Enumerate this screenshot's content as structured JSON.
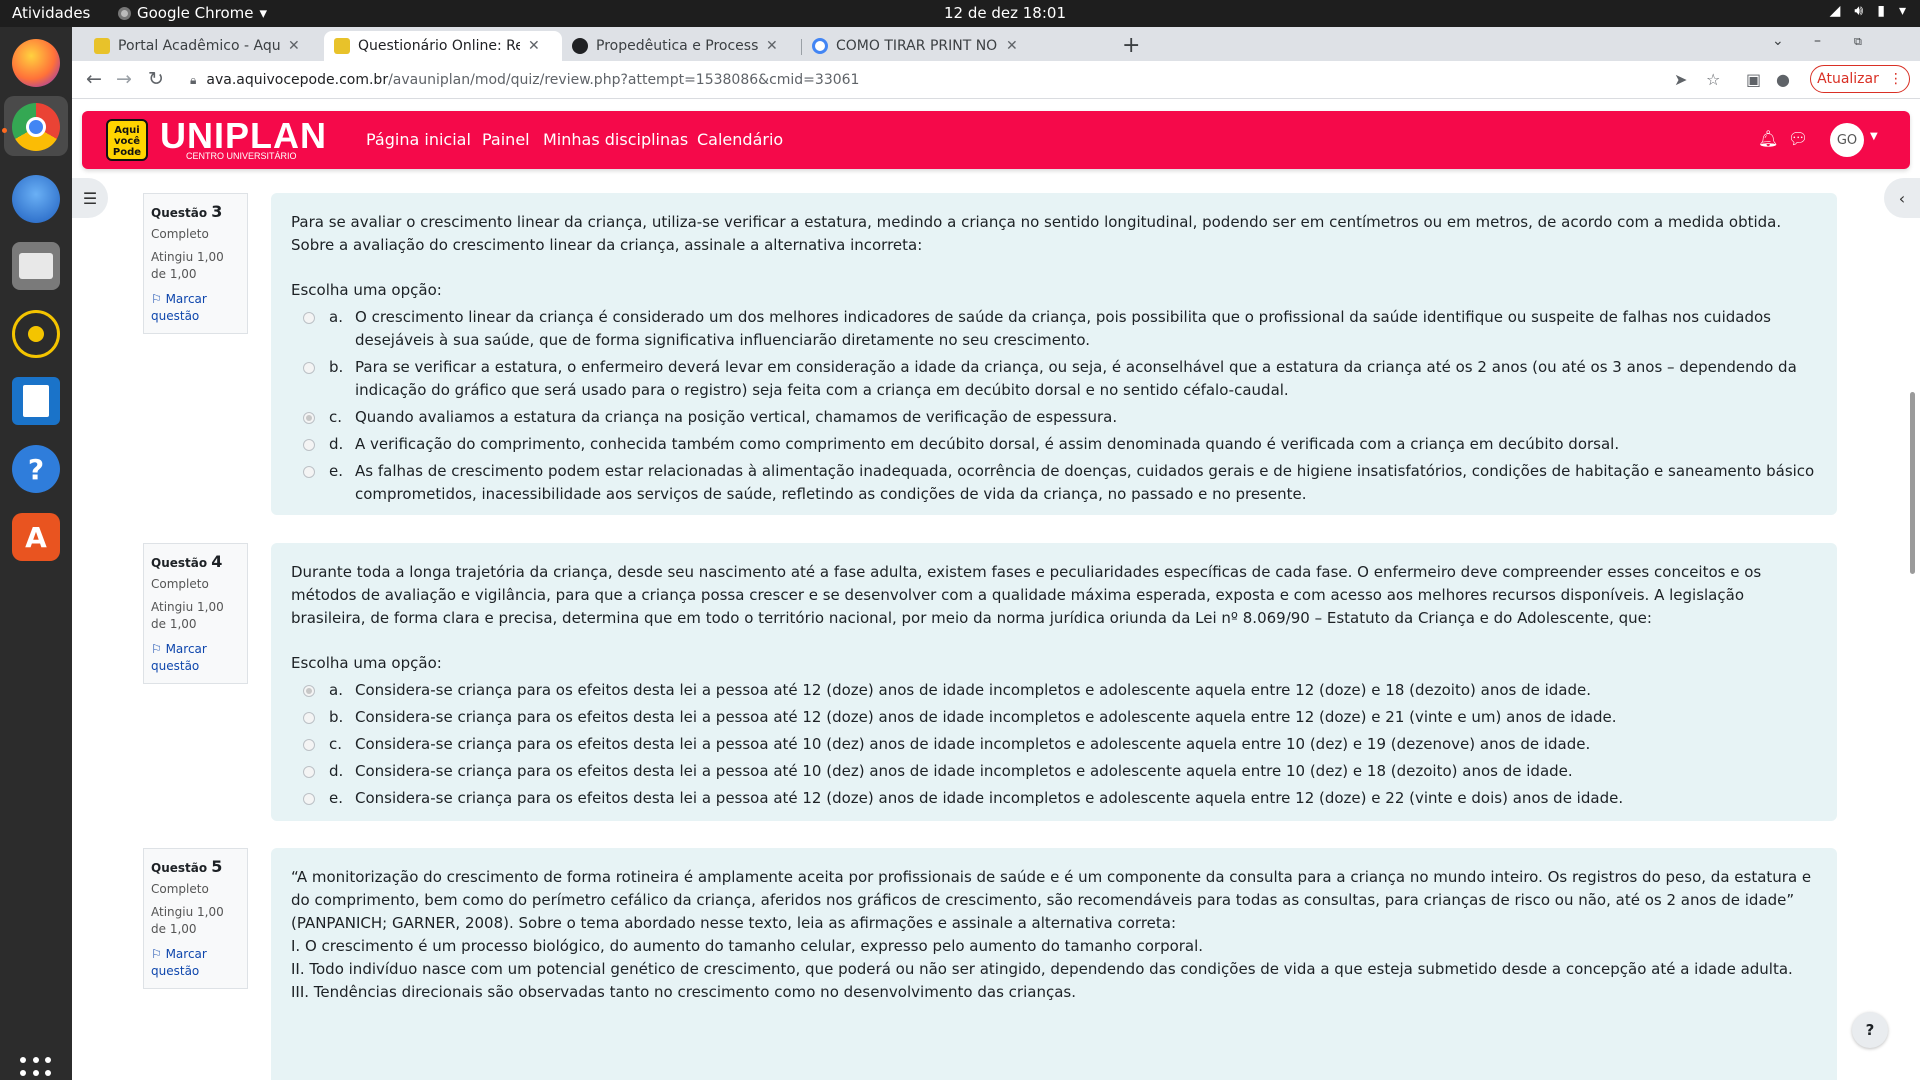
{
  "system_bar": {
    "activities": "Atividades",
    "app_name": "Google Chrome",
    "clock": "12 de dez  18:01"
  },
  "browser": {
    "tabs": [
      {
        "title": "Portal Acadêmico - Aqui V",
        "favicon_color": "#e8c22a"
      },
      {
        "title": "Questionário Online: Rev",
        "favicon_color": "#e8c22a"
      },
      {
        "title": "Propedêutica e Processo",
        "favicon_color": "#202124"
      },
      {
        "title": "COMO TIRAR PRINT NO N",
        "favicon_color": "#4285f4"
      }
    ],
    "url_domain": "ava.aquivocepode.com.br",
    "url_path": "/avauniplan/mod/quiz/review.php?attempt=1538086&cmid=33061",
    "update_label": "Atualizar"
  },
  "site": {
    "logo_badge": "Aqui você Pode",
    "logo_text": "UNIPLAN",
    "logo_subtitle": "CENTRO UNIVERSITÁRIO",
    "nav": [
      "Página inicial",
      "Painel",
      "Minhas disciplinas",
      "Calendário"
    ],
    "avatar_initials": "GO",
    "brand_color": "#f5094a"
  },
  "questions": [
    {
      "label": "Questão",
      "number": "3",
      "state": "Completo",
      "grade": "Atingiu 1,00 de 1,00",
      "flag": "Marcar questão",
      "text": [
        "Para se avaliar o crescimento linear da criança, utiliza-se verificar a estatura, medindo a criança no sentido longitudinal, podendo ser em centímetros ou em metros, de acordo com a medida obtida. Sobre a avaliação do crescimento linear da criança, assinale a alternativa incorreta:"
      ],
      "prompt": "Escolha uma opção:",
      "selected": 2,
      "answers": [
        {
          "letter": "a.",
          "text": "O crescimento linear da criança é considerado um dos melhores indicadores de saúde da criança, pois possibilita que o profissional da saúde identifique ou suspeite de falhas nos cuidados desejáveis à sua saúde, que de forma significativa influenciarão diretamente no seu crescimento."
        },
        {
          "letter": "b.",
          "text": "Para se verificar a estatura, o enfermeiro deverá levar em consideração a idade da criança, ou seja, é aconselhável que a estatura da criança até os 2 anos (ou até os 3 anos – dependendo da indicação do gráfico que será usado para o registro) seja feita com a criança em decúbito dorsal e no sentido céfalo-caudal."
        },
        {
          "letter": "c.",
          "text": "Quando avaliamos a estatura da criança na posição vertical, chamamos de verificação de espessura."
        },
        {
          "letter": "d.",
          "text": "A verificação do comprimento, conhecida também como comprimento em decúbito dorsal, é assim denominada quando é verificada com a criança em decúbito dorsal."
        },
        {
          "letter": "e.",
          "text": "As falhas de crescimento podem estar relacionadas à alimentação inadequada, ocorrência de doenças, cuidados gerais e de higiene insatisfatórios, condições de habitação e saneamento básico comprometidos, inacessibilidade aos serviços de saúde, refletindo as condições de vida da criança, no passado e no presente."
        }
      ]
    },
    {
      "label": "Questão",
      "number": "4",
      "state": "Completo",
      "grade": "Atingiu 1,00 de 1,00",
      "flag": "Marcar questão",
      "text": [
        "Durante toda a longa trajetória da criança, desde seu nascimento até a fase adulta, existem fases e peculiaridades específicas de cada fase. O enfermeiro deve compreender esses conceitos e os métodos de avaliação e vigilância, para que a criança possa crescer e se desenvolver com a qualidade máxima esperada, exposta e com acesso aos melhores recursos disponíveis. A legislação brasileira, de forma clara e precisa, determina que em todo o território nacional, por meio da norma jurídica oriunda da Lei nº 8.069/90 – Estatuto da Criança e do Adolescente, que:"
      ],
      "prompt": "Escolha uma opção:",
      "selected": 0,
      "answers": [
        {
          "letter": "a.",
          "text": "Considera-se criança para os efeitos desta lei a pessoa até 12 (doze) anos de idade incompletos e adolescente aquela entre 12 (doze) e 18 (dezoito) anos de idade."
        },
        {
          "letter": "b.",
          "text": "Considera-se criança para os efeitos desta lei a pessoa até 12 (doze) anos de idade incompletos e adolescente aquela entre 12 (doze) e 21 (vinte e um) anos de idade."
        },
        {
          "letter": "c.",
          "text": "Considera-se criança para os efeitos desta lei a pessoa até 10 (dez) anos de idade incompletos e adolescente aquela entre 10 (dez) e 19 (dezenove) anos de idade."
        },
        {
          "letter": "d.",
          "text": "Considera-se criança para os efeitos desta lei a pessoa até 10 (dez) anos de idade incompletos e adolescente aquela entre 10 (dez) e 18 (dezoito) anos de idade."
        },
        {
          "letter": "e.",
          "text": "Considera-se criança para os efeitos desta lei a pessoa até 12 (doze) anos de idade incompletos e adolescente aquela entre 12 (doze) e 22 (vinte e dois) anos de idade."
        }
      ]
    },
    {
      "label": "Questão",
      "number": "5",
      "state": "Completo",
      "grade": "Atingiu 1,00 de 1,00",
      "flag": "Marcar questão",
      "text": [
        "“A monitorização do crescimento de forma rotineira é amplamente aceita por profissionais de saúde e é um componente da consulta para a criança no mundo inteiro. Os registros do peso, da estatura e do comprimento, bem como do perímetro cefálico da criança, aferidos nos gráficos de crescimento, são recomendáveis para todas as consultas, para crianças de risco ou não, até os 2 anos de idade” (PANPANICH; GARNER, 2008). Sobre o tema abordado nesse texto, leia as afirmações e assinale a alternativa correta:",
        "I. O crescimento é um processo biológico, do aumento do tamanho celular, expresso pelo aumento do tamanho corporal.",
        "II. Todo indivíduo nasce com um potencial genético de crescimento, que poderá ou não ser atingido, dependendo das condições de vida a que esteja submetido desde a concepção até a idade adulta.",
        "III. Tendências direcionais são observadas tanto no crescimento como no desenvolvimento das crianças."
      ]
    }
  ],
  "help_label": "?"
}
